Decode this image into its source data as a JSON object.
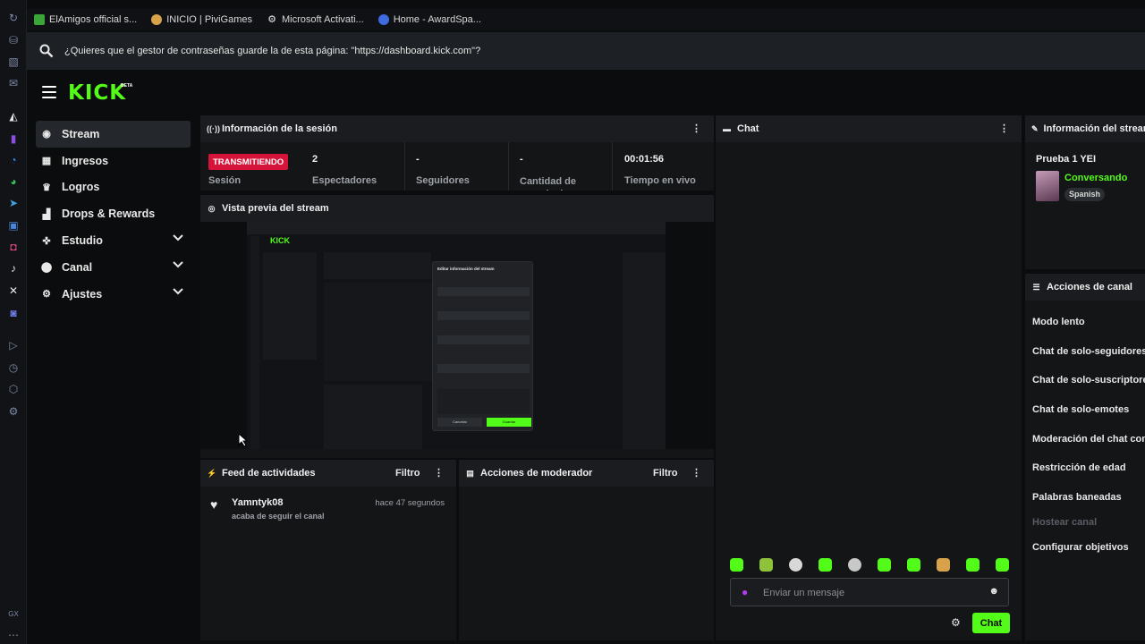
{
  "bookmarks": [
    {
      "label": "ElAmigos official s...",
      "color": "#3aa63a"
    },
    {
      "label": "INICIO | PiviGames",
      "color": "#d8a24a"
    },
    {
      "label": "Microsoft Activati...",
      "color": "#e8e8e8"
    },
    {
      "label": "Home - AwardSpa...",
      "color": "#3e6be0"
    }
  ],
  "password_prompt": {
    "text": "¿Quieres que el gestor de contraseñas guarde la de esta página: \"https://dashboard.kick.com\"?"
  },
  "header": {
    "logo": "KICK",
    "logo_badge": "BETA"
  },
  "sidebar": {
    "items": [
      {
        "label": "Stream",
        "icon": "broadcast-icon",
        "glyph": "◉",
        "active": true
      },
      {
        "label": "Ingresos",
        "icon": "wallet-icon",
        "glyph": "▦"
      },
      {
        "label": "Logros",
        "icon": "trophy-icon",
        "glyph": "♛"
      },
      {
        "label": "Drops & Rewards",
        "icon": "drops-icon",
        "glyph": "▟"
      },
      {
        "label": "Estudio",
        "icon": "studio-icon",
        "glyph": "✜",
        "expandable": true
      },
      {
        "label": "Canal",
        "icon": "channel-icon",
        "glyph": "⬤",
        "expandable": true
      },
      {
        "label": "Ajustes",
        "icon": "settings-icon",
        "glyph": "⚙",
        "expandable": true
      }
    ]
  },
  "session_info": {
    "title": "Información de la sesión",
    "live_label": "TRANSMITIENDO",
    "session_label": "Sesión",
    "stats": [
      {
        "value": "2",
        "label": "Espectadores"
      },
      {
        "value": "-",
        "label": "Seguidores"
      },
      {
        "value": "-",
        "label": "Cantidad de suscripciones"
      },
      {
        "value": "00:01:56",
        "label": "Tiempo en vivo"
      }
    ]
  },
  "stream_preview": {
    "title": "Vista previa del stream",
    "modal_title": "Editar información del stream",
    "cancel_label": "Cancelar",
    "save_label": "Guardar"
  },
  "activity_feed": {
    "title": "Feed de actividades",
    "filter_label": "Filtro",
    "events": [
      {
        "user": "Yamntyk08",
        "action": "acaba de seguir el canal",
        "time": "hace 47 segundos"
      }
    ]
  },
  "mod_actions": {
    "title": "Acciones de moderador",
    "filter_label": "Filtro"
  },
  "chat": {
    "title": "Chat",
    "input_placeholder": "Enviar un mensaje",
    "send_label": "Chat",
    "emote_count": 10
  },
  "stream_info": {
    "title": "Información del stream",
    "stream_title": "Prueba 1 YEI",
    "category": "Conversando",
    "language": "Spanish"
  },
  "channel_actions": {
    "title": "Acciones de canal",
    "items": [
      {
        "label": "Modo lento",
        "enabled": true
      },
      {
        "label": "Chat de solo-seguidores",
        "enabled": true
      },
      {
        "label": "Chat de solo-suscriptores",
        "enabled": true
      },
      {
        "label": "Chat de solo-emotes",
        "enabled": true
      },
      {
        "label": "Moderación del chat con IA",
        "enabled": true
      },
      {
        "label": "Restricción de edad",
        "enabled": true
      },
      {
        "label": "Palabras baneadas",
        "enabled": true
      },
      {
        "label": "Hostear canal",
        "enabled": false
      },
      {
        "label": "Configurar objetivos",
        "enabled": true
      }
    ]
  },
  "colors": {
    "accent": "#53fc18",
    "live_red": "#d6143a",
    "panel_bg": "#141517",
    "page_bg": "#0b0c0d"
  }
}
